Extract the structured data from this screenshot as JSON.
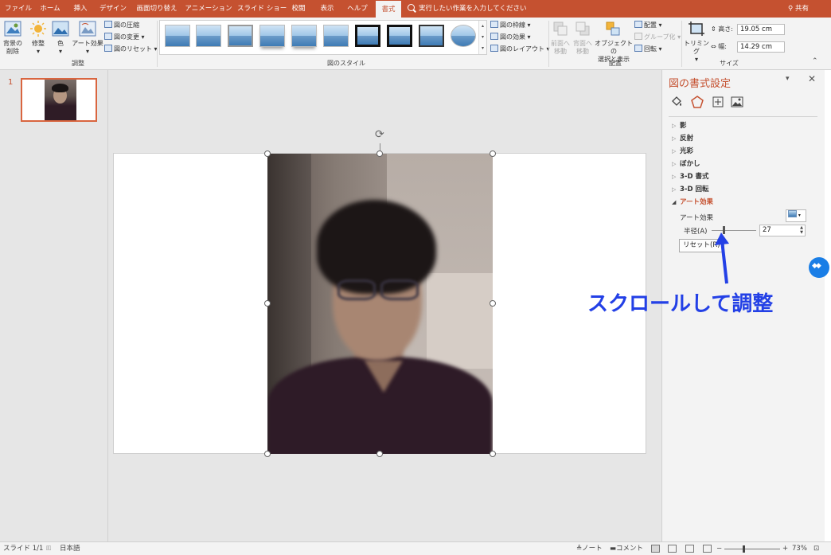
{
  "tabs": [
    "ファイル",
    "ホーム",
    "挿入",
    "デザイン",
    "画面切り替え",
    "アニメーション",
    "スライド ショー",
    "校閲",
    "表示",
    "ヘルプ",
    "書式"
  ],
  "active_tab": "書式",
  "tell_me": "実行したい作業を入力してください",
  "share": "共有",
  "ribbon": {
    "adjust": {
      "remove_bg": "背景の削除",
      "remove_bg_line1": "背景の",
      "remove_bg_line2": "削除",
      "corrections": "修整",
      "color": "色",
      "artistic": "アート効果",
      "compress": "図の圧縮",
      "change": "図の変更",
      "reset": "図のリセット",
      "group_label": "調整"
    },
    "styles": {
      "border": "図の枠線",
      "effects": "図の効果",
      "layout": "図のレイアウト",
      "group_label": "図のスタイル"
    },
    "arrange": {
      "bring_forward_1": "前面へ",
      "bring_forward_2": "移動",
      "send_backward_1": "背面へ",
      "send_backward_2": "移動",
      "selection_1": "オブジェクトの",
      "selection_2": "選択と表示",
      "align": "配置",
      "group": "グループ化",
      "rotate": "回転",
      "group_label": "配置"
    },
    "size": {
      "crop": "トリミング",
      "height_label": "高さ:",
      "height_value": "19.05 cm",
      "width_label": "幅:",
      "width_value": "14.29 cm",
      "group_label": "サイズ"
    }
  },
  "slides_panel": {
    "slide_number": "1"
  },
  "format_pane": {
    "title": "図の書式設定",
    "sections": [
      "影",
      "反射",
      "光彩",
      "ぼかし",
      "3-D 書式",
      "3-D 回転",
      "アート効果"
    ],
    "open_section": "アート効果",
    "art_effect_label": "アート効果",
    "radius_label": "半径(A)",
    "radius_value": "27",
    "radius_fraction": 0.27,
    "reset_label": "リセット(R)"
  },
  "annotation": {
    "text": "スクロールして調整",
    "color": "#2340e6"
  },
  "status_bar": {
    "slide_info": "スライド 1/1",
    "language": "日本語",
    "notes": "ノート",
    "comments": "コメント",
    "zoom": "73%"
  },
  "colors": {
    "accent": "#c55130",
    "pane_title": "#c55130"
  }
}
